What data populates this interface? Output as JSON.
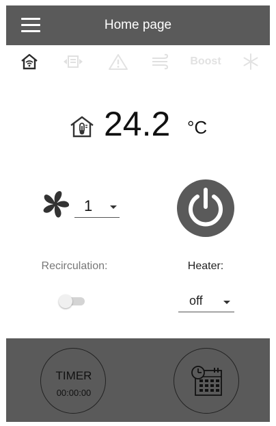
{
  "header": {
    "title": "Home page",
    "menu_icon": "hamburger-menu-icon",
    "background": "#5a5a5a"
  },
  "tabs": [
    {
      "icon": "home-wifi-icon",
      "active": true
    },
    {
      "icon": "ventilation-unit-icon",
      "active": false
    },
    {
      "icon": "warning-icon",
      "active": false
    },
    {
      "icon": "airflow-icon",
      "active": false
    },
    {
      "label": "Boost",
      "active": false
    },
    {
      "icon": "snowflake-icon",
      "active": false
    }
  ],
  "temperature": {
    "icon": "home-thermometer-icon",
    "value": "24.2",
    "unit": "°C"
  },
  "fan": {
    "icon": "fan-icon",
    "speed": "1"
  },
  "power": {
    "icon": "power-icon"
  },
  "recirculation": {
    "label": "Recirculation:",
    "enabled": false
  },
  "heater": {
    "label": "Heater:",
    "value": "off"
  },
  "bottom": {
    "timer_label": "TIMER",
    "timer_value": "00:00:00",
    "schedule_icon": "schedule-calendar-icon"
  }
}
